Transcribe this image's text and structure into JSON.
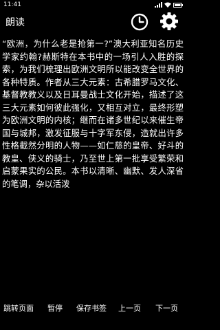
{
  "status_bar": {
    "time": "11:41"
  },
  "app_bar": {
    "title": "朗读",
    "icons": [
      "clock-icon",
      "gear-icon"
    ]
  },
  "content": {
    "text": "“欧洲，为什么老是抢第一?”澳大利亚知名历史学家约翰?赫斯特在本书中的一场引人入胜的探索，为我们梳理出欧洲文明所以能改变全世界的各种特质。作者从三大元素：古希腊罗马文化、基督教教义以及日耳曼战士文化开始，描述了这三大元素如何彼此强化，又相互对立，最终形塑为欧洲文明的内核；继而在诸多世纪以来催生帝国与城邦，激发征服与十字军东侵，造就出许多性格截然分明的人物——如仁慈的皇帝、好斗的教皇、侠义的骑士，乃至世上第一批享受繁荣和启蒙果实的公民。本书以清晰、幽默、发人深省的笔调，杂以活泼"
  },
  "bottom_bar": {
    "jump_page": "跳转页面",
    "pause": "暂停",
    "save_bookmark": "保存书签",
    "prev_page": "上一页",
    "next_page": "下一页"
  }
}
